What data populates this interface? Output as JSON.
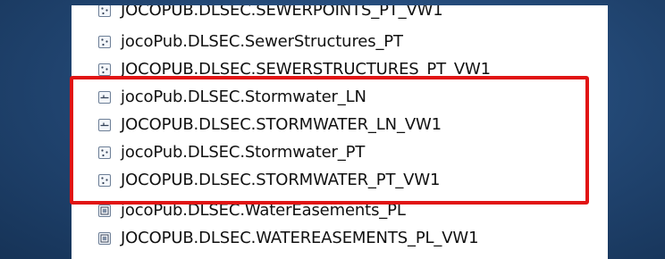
{
  "layers": [
    {
      "label": "JOCOPUB.DLSEC.SEWERPOINTS_PT_VW1",
      "icon": "point-feature-icon"
    },
    {
      "label": "jocoPub.DLSEC.SewerStructures_PT",
      "icon": "point-feature-icon"
    },
    {
      "label": "JOCOPUB.DLSEC.SEWERSTRUCTURES_PT_VW1",
      "icon": "point-feature-icon"
    },
    {
      "label": "jocoPub.DLSEC.Stormwater_LN",
      "icon": "line-feature-icon"
    },
    {
      "label": "JOCOPUB.DLSEC.STORMWATER_LN_VW1",
      "icon": "line-feature-icon"
    },
    {
      "label": "jocoPub.DLSEC.Stormwater_PT",
      "icon": "point-feature-icon"
    },
    {
      "label": "JOCOPUB.DLSEC.STORMWATER_PT_VW1",
      "icon": "point-feature-icon"
    },
    {
      "label": "jocoPub.DLSEC.WaterEasements_PL",
      "icon": "polygon-feature-icon"
    },
    {
      "label": "JOCOPUB.DLSEC.WATEREASEMENTS_PL_VW1",
      "icon": "polygon-feature-icon"
    }
  ],
  "colors": {
    "highlight": "#e11414",
    "background": "#1f3f6b",
    "panel": "#ffffff",
    "text": "#111111"
  }
}
